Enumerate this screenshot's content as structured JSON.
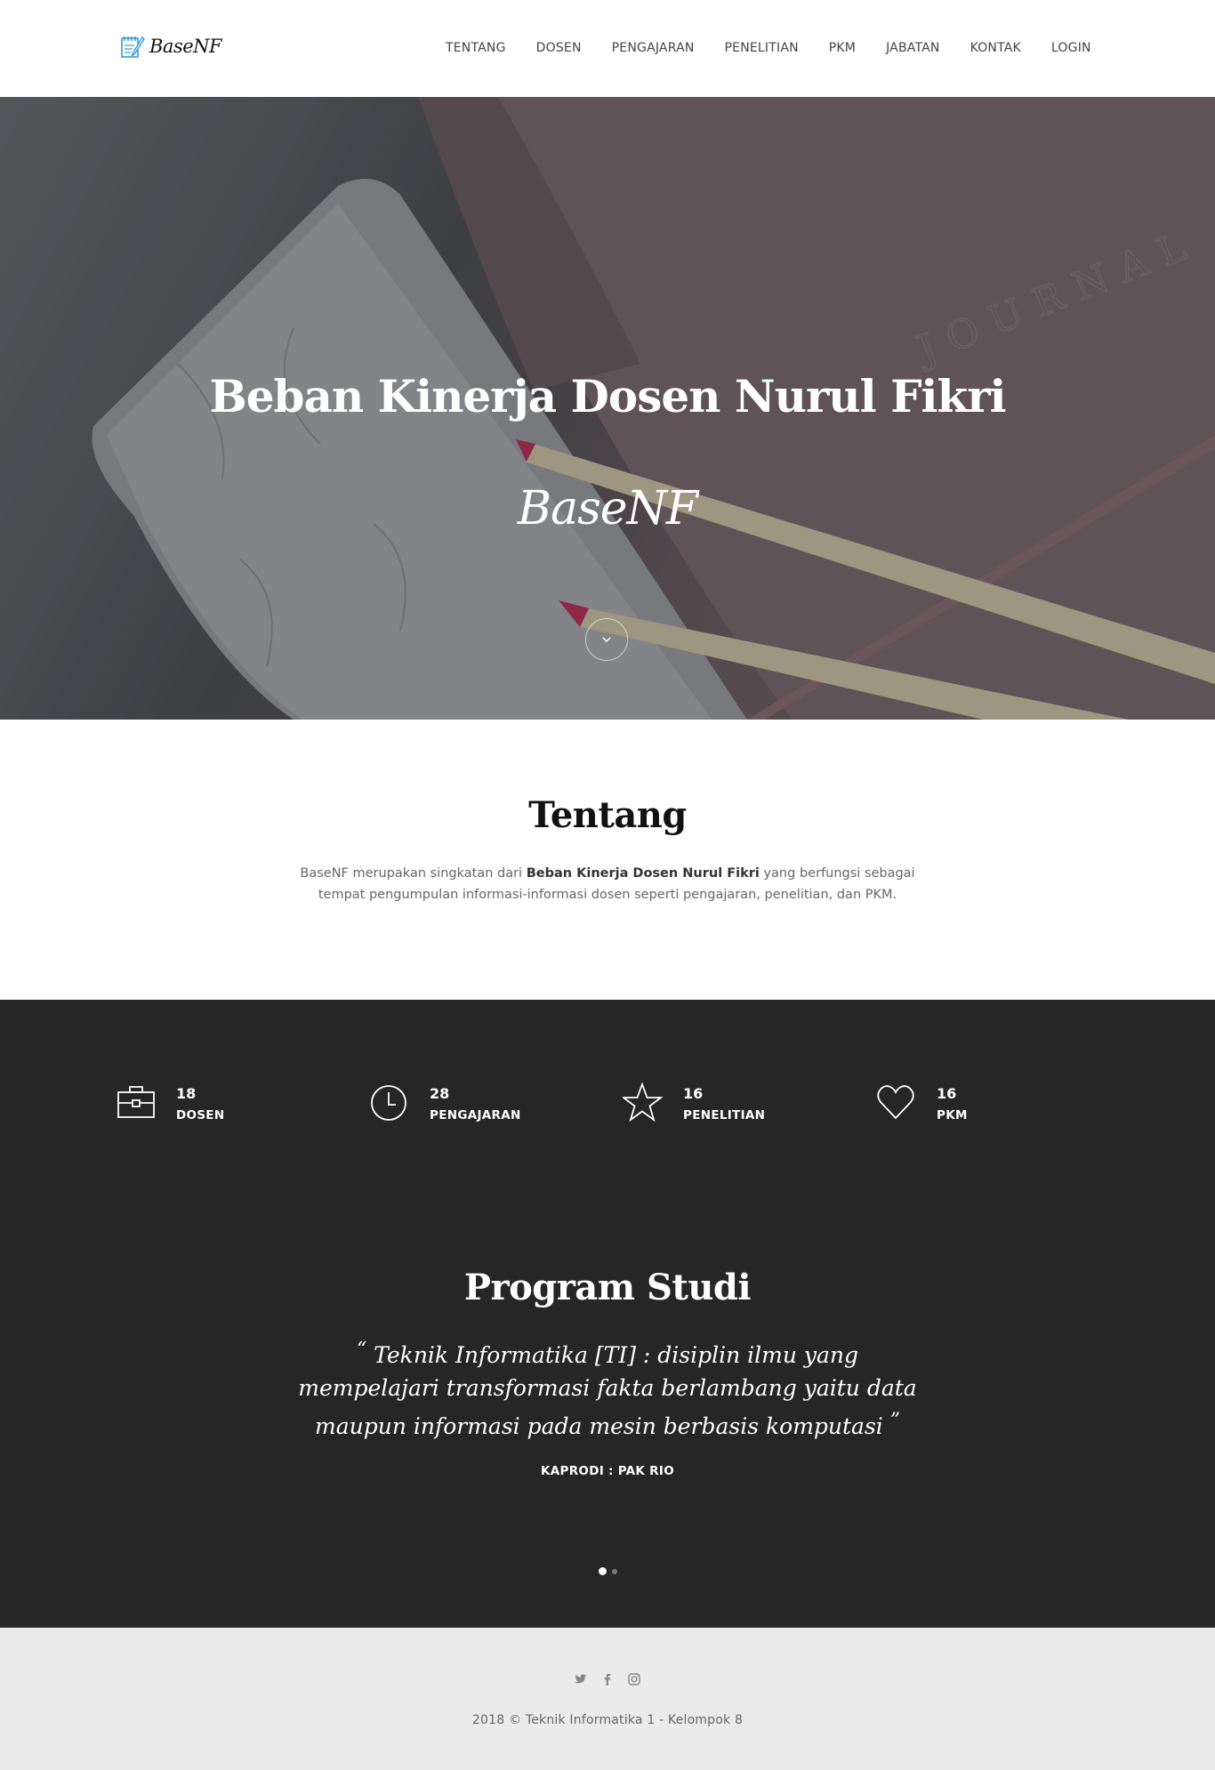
{
  "brand": {
    "name": "BaseNF",
    "icon": "notepad-pencil-icon",
    "accent": "#3a9ad9"
  },
  "nav": {
    "items": [
      "TENTANG",
      "DOSEN",
      "PENGAJARAN",
      "PENELITIAN",
      "PKM",
      "JABATAN",
      "KONTAK",
      "LOGIN"
    ]
  },
  "hero": {
    "title": "Beban Kinerja Dosen Nurul Fikri",
    "subtitle": "BaseNF",
    "scroll_icon": "chevron-down-icon",
    "photo_text": "JOURNAL"
  },
  "about": {
    "heading": "Tentang",
    "text_before": "BaseNF merupakan singkatan dari ",
    "text_bold": "Beban Kinerja Dosen Nurul Fikri",
    "text_after": " yang berfungsi sebagai tempat pengumpulan informasi-informasi dosen seperti pengajaran, penelitian, dan PKM."
  },
  "stats": [
    {
      "icon": "briefcase-icon",
      "value": "18",
      "label": "DOSEN"
    },
    {
      "icon": "clock-icon",
      "value": "28",
      "label": "PENGAJARAN"
    },
    {
      "icon": "star-icon",
      "value": "16",
      "label": "PENELITIAN"
    },
    {
      "icon": "heart-icon",
      "value": "16",
      "label": "PKM"
    }
  ],
  "program": {
    "heading": "Program Studi",
    "quote": "Teknik Informatika [TI] : disiplin ilmu yang mempelajari transformasi fakta berlambang yaitu data maupun informasi pada mesin berbasis komputasi",
    "author": "KAPRODI : PAK RIO",
    "slides": 2,
    "active_slide": 1
  },
  "footer": {
    "socials": [
      "twitter-icon",
      "facebook-icon",
      "instagram-icon"
    ],
    "copyright": "2018 © Teknik Informatika 1 - Kelompok 8"
  },
  "colors": {
    "dark_bg": "#262626",
    "footer_bg": "#ebebeb"
  }
}
